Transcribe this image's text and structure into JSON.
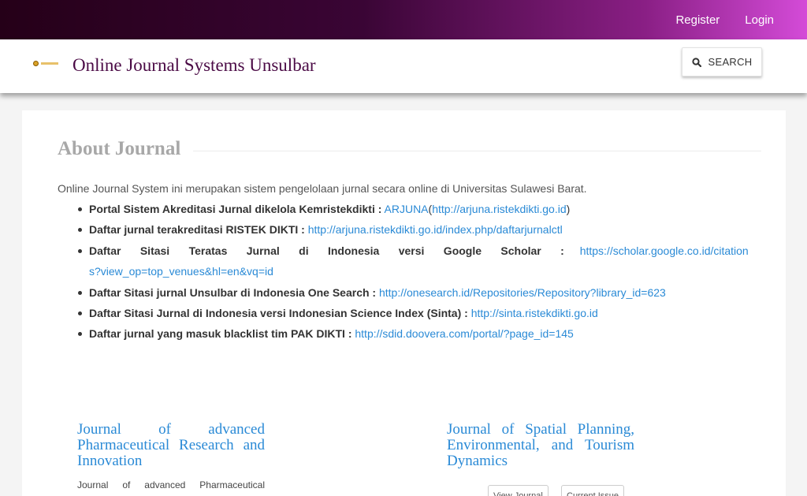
{
  "nav": {
    "register": "Register",
    "login": "Login"
  },
  "header": {
    "site_title": "Online Journal Systems Unsulbar",
    "search_label": "SEARCH"
  },
  "about": {
    "title": "About Journal",
    "intro": "Online Journal System ini merupakan sistem pengelolaan jurnal secara online di Universitas Sulawesi Barat.",
    "items": [
      {
        "label": "Portal Sistem Akreditasi Jurnal dikelola Kemristekdikti :",
        "link": "ARJUNA",
        "paren_open": "(",
        "link2": "http://arjuna.ristekdikti.go.id",
        "paren_close": ")"
      },
      {
        "label": "Daftar jurnal terakreditasi RISTEK DIKTI :",
        "link": "http://arjuna.ristekdikti.go.id/index.php/daftarjurnalctl"
      },
      {
        "label": "Daftar Sitasi Teratas Jurnal di Indonesia versi Google Scholar :",
        "link": "https://scholar.google.co.id/citations?view_op=top_venues&hl=en&vq=id"
      },
      {
        "label": "Daftar Sitasi jurnal Unsulbar di Indonesia One Search :",
        "link": "http://onesearch.id/Repositories/Repository?library_id=623"
      },
      {
        "label": "Daftar Sitasi Jurnal di Indonesia versi Indonesian Science Index (Sinta) :",
        "link": "http://sinta.ristekdikti.go.id"
      },
      {
        "label": "Daftar jurnal yang masuk blacklist tim PAK DIKTI :",
        "link": "http://sdid.doovera.com/portal/?page_id=145"
      }
    ]
  },
  "journals": [
    {
      "title": "Journal of advanced Pharmaceutical Research and Innovation",
      "description": "Journal of advanced Pharmaceutical"
    },
    {
      "title": "Journal of Spatial Planning, Environmental, and Tourism Dynamics",
      "view_journal": "View Journal",
      "current_issue": "Current Issue"
    }
  ]
}
